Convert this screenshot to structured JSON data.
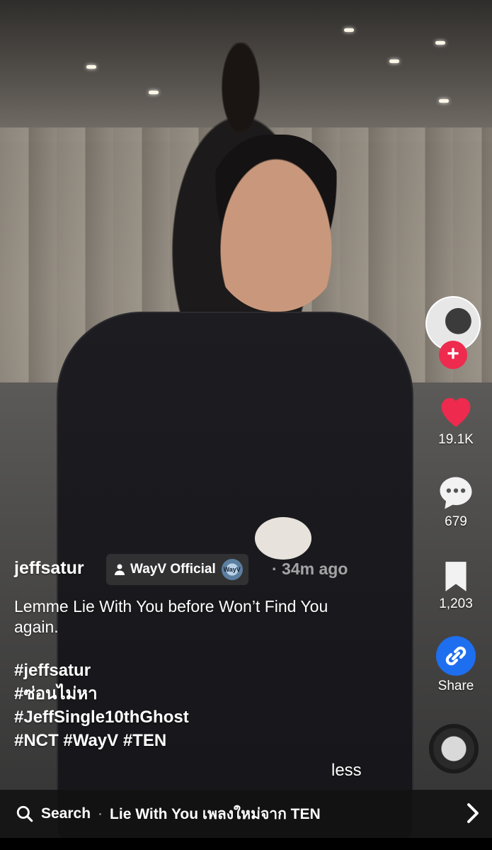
{
  "post": {
    "username": "jeffsatur",
    "collaborator": "WayV Official",
    "collaborator_badge": "WayV",
    "time": "· 34m ago",
    "description": "Lemme Lie With You before Won’t Find You again.",
    "hashtags": [
      "#jeffsatur",
      "#ซ่อนไม่หา",
      "#JeffSingle10thGhost",
      "#NCT #WayV #TEN"
    ],
    "less_label": "less"
  },
  "actions": {
    "likes": "19.1K",
    "comments": "679",
    "saves": "1,203",
    "share_label": "Share",
    "follow_symbol": "+"
  },
  "search": {
    "label": "Search",
    "separator": "·",
    "query": "Lie With You เพลงใหม่จาก TEN"
  },
  "colors": {
    "like": "#ee2a4e",
    "share_circle": "#1e6ef0",
    "follow": "#ee2a4e"
  },
  "icons": {
    "like": "heart-icon",
    "comment": "comment-bubble-icon",
    "save": "bookmark-icon",
    "share": "link-icon",
    "search": "search-icon",
    "chevron": "chevron-right-icon",
    "person": "person-icon"
  }
}
